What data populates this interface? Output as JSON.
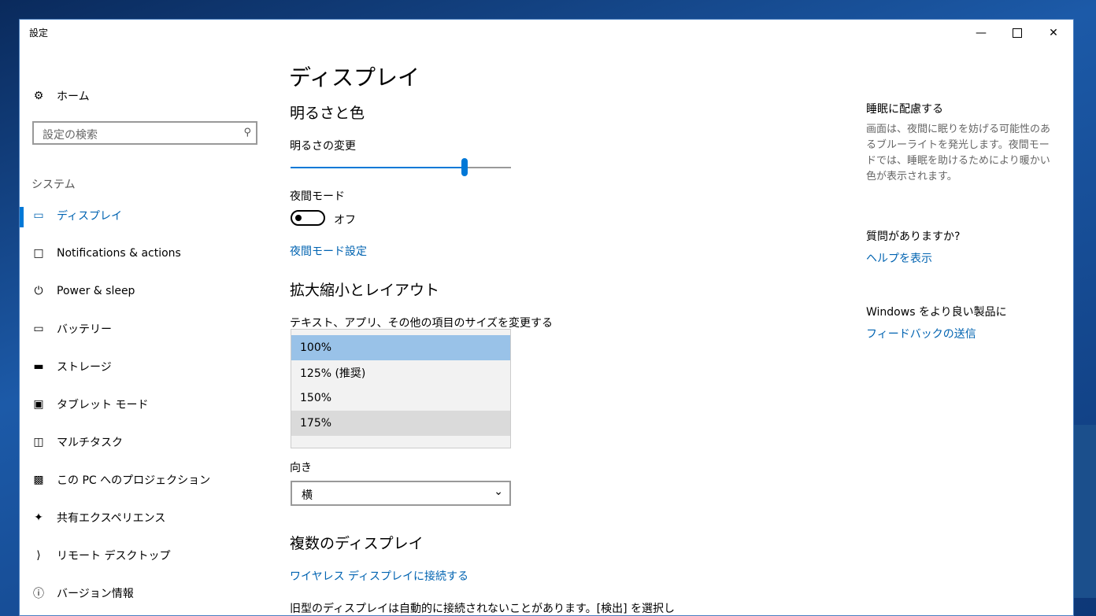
{
  "window": {
    "title": "設定"
  },
  "sidebar": {
    "home_label": "ホーム",
    "search_placeholder": "設定の検索",
    "section_label": "システム",
    "items": [
      {
        "label": "ディスプレイ",
        "icon": "monitor-icon",
        "active": true
      },
      {
        "label": "Notifications & actions",
        "icon": "notification-icon"
      },
      {
        "label": "Power & sleep",
        "icon": "power-icon"
      },
      {
        "label": "バッテリー",
        "icon": "battery-icon"
      },
      {
        "label": "ストレージ",
        "icon": "storage-icon"
      },
      {
        "label": "タブレット モード",
        "icon": "tablet-mode-icon"
      },
      {
        "label": "マルチタスク",
        "icon": "multitask-icon"
      },
      {
        "label": "この PC へのプロジェクション",
        "icon": "projection-icon"
      },
      {
        "label": "共有エクスペリエンス",
        "icon": "shared-experience-icon"
      },
      {
        "label": "リモート デスクトップ",
        "icon": "remote-desktop-icon"
      },
      {
        "label": "バージョン情報",
        "icon": "info-icon"
      }
    ]
  },
  "main": {
    "title": "ディスプレイ",
    "brightness_heading": "明るさと色",
    "brightness_label": "明るさの変更",
    "brightness_value": 0.79,
    "night_mode_label": "夜間モード",
    "night_mode_state": "オフ",
    "night_mode_settings_link": "夜間モード設定",
    "scale_heading": "拡大縮小とレイアウト",
    "scale_label": "テキスト、アプリ、その他の項目のサイズを変更する",
    "scale_options": [
      "100%",
      "125% (推奨)",
      "150%",
      "175%"
    ],
    "scale_selected": "100%",
    "orientation_label": "向き",
    "orientation_value": "横",
    "multi_heading": "複数のディスプレイ",
    "wireless_link": "ワイヤレス ディスプレイに接続する",
    "note": "旧型のディスプレイは自動的に接続されないことがあります。[検出] を選択し"
  },
  "right": {
    "sleep_heading": "睡眠に配慮する",
    "sleep_text": "画面は、夜間に眠りを妨げる可能性のあるブルーライトを発光します。夜間モードでは、睡眠を助けるためにより暖かい色が表示されます。",
    "question_heading": "質問がありますか?",
    "help_link": "ヘルプを表示",
    "feedback_heading": "Windows をより良い製品に",
    "feedback_link": "フィードバックの送信"
  },
  "colors": {
    "accent": "#0078d7",
    "link": "#0063b1",
    "selected_option": "#99c2e8"
  }
}
